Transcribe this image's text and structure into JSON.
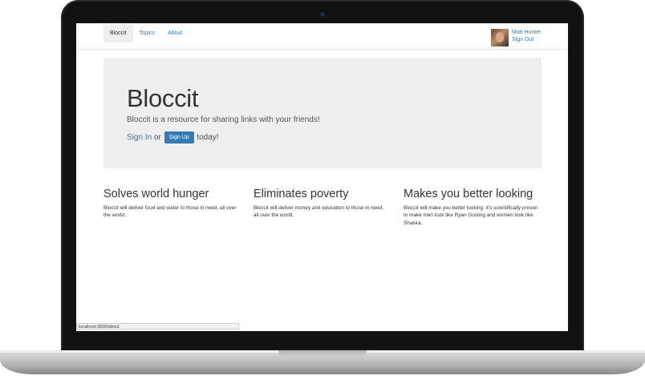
{
  "nav": {
    "items": [
      {
        "label": "Bloccit",
        "active": true
      },
      {
        "label": "Topics",
        "active": false
      },
      {
        "label": "About",
        "active": false
      }
    ],
    "user": {
      "name": "Matt Hunter",
      "sign_out": "Sign Out"
    }
  },
  "jumbotron": {
    "title": "Bloccit",
    "lead": "Bloccit is a resource for sharing links with your friends!",
    "sign_in": "Sign In",
    "or_text": "or",
    "sign_up": "Sign Up",
    "today_text": "today!"
  },
  "features": [
    {
      "title": "Solves world hunger",
      "text": "Bloccit will deliver food and water to those in need, all over the world."
    },
    {
      "title": "Eliminates poverty",
      "text": "Bloccit will deliver money and education to those in need, all over the world."
    },
    {
      "title": "Makes you better looking",
      "text": "Bloccit will make you better looking: it's scientifically proven to make men look like Ryan Gosling and women look like Shakira."
    }
  ],
  "status_bar": {
    "url": "localhost:3000/about"
  },
  "colors": {
    "link": "#337ab7",
    "jumbotron_bg": "#eeeeee"
  }
}
